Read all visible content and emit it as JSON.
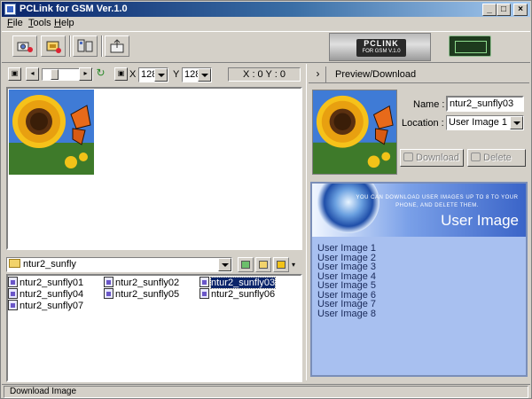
{
  "window": {
    "title": "PCLink for GSM Ver.1.0"
  },
  "menu": [
    {
      "label": "File",
      "hotkey": "F",
      "rest": "ile"
    },
    {
      "label": "Tools",
      "hotkey": "T",
      "rest": "ools"
    },
    {
      "label": "Help",
      "hotkey": "H",
      "rest": "elp"
    }
  ],
  "toolbar": {
    "buttons": [
      "camera-icon",
      "sim-card-icon",
      "phone-transfer-icon",
      "export-icon"
    ],
    "logo": {
      "main": "PCLINK",
      "sub": "FOR GSM V.1.0"
    }
  },
  "image_controls": {
    "x_label": "X",
    "x_value": "128",
    "y_label": "Y",
    "y_value": "128",
    "coords": "X : 0  Y : 0"
  },
  "folder": {
    "current": "ntur2_sunfly"
  },
  "files": [
    {
      "name": "ntur2_sunfly01",
      "selected": false
    },
    {
      "name": "ntur2_sunfly02",
      "selected": false
    },
    {
      "name": "ntur2_sunfly03",
      "selected": true
    },
    {
      "name": "ntur2_sunfly04",
      "selected": false
    },
    {
      "name": "ntur2_sunfly05",
      "selected": false
    },
    {
      "name": "ntur2_sunfly06",
      "selected": false
    },
    {
      "name": "ntur2_sunfly07",
      "selected": false
    }
  ],
  "right_panel": {
    "header": "Preview/Download",
    "name_label": "Name :",
    "name_value": "ntur2_sunfly03",
    "location_label": "Location :",
    "location_value": "User Image 1",
    "download_label": "Download",
    "delete_label": "Delete"
  },
  "info": {
    "banner_sub": "YOU CAN DOWNLOAD USER IMAGES UP TO 8 TO YOUR PHONE, AND DELETE THEM.",
    "banner_title": "User Image",
    "slots": [
      "User Image 1",
      "User Image 2",
      "User Image 3",
      "User Image 4",
      "User Image 5",
      "User Image 6",
      "User Image 7",
      "User Image 8"
    ]
  },
  "status": {
    "text": "Download Image"
  },
  "colors": {
    "title_bar": "#0a246a",
    "info_panel": "#a8c0f0",
    "selection": "#0a246a"
  }
}
